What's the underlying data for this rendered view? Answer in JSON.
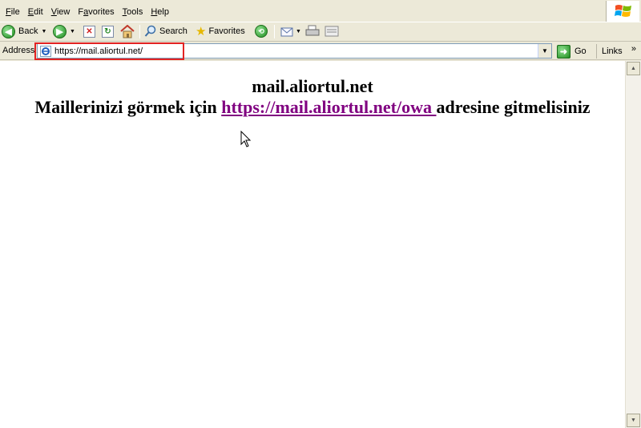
{
  "menu": [
    {
      "label": "File",
      "key": "F",
      "rest": "ile"
    },
    {
      "label": "Edit",
      "key": "E",
      "rest": "dit"
    },
    {
      "label": "View",
      "key": "V",
      "rest": "iew"
    },
    {
      "label": "Favorites",
      "key": "a",
      "pre": "F",
      "rest": "vorites"
    },
    {
      "label": "Tools",
      "key": "T",
      "rest": "ools"
    },
    {
      "label": "Help",
      "key": "H",
      "rest": "elp"
    }
  ],
  "toolbar": {
    "back_label": "Back",
    "search_label": "Search",
    "favorites_label": "Favorites"
  },
  "address": {
    "label": "Address",
    "value": "https://mail.aliortul.net/",
    "go_label": "Go",
    "links_label": "Links"
  },
  "page": {
    "title": "mail.aliortul.net",
    "text_before": "Maillerinizi görmek için ",
    "link_text": "https://mail.aliortul.net/owa ",
    "text_after": "adresine gitmelisiniz"
  },
  "colors": {
    "highlight": "#e32323",
    "visited_link": "#800080"
  }
}
